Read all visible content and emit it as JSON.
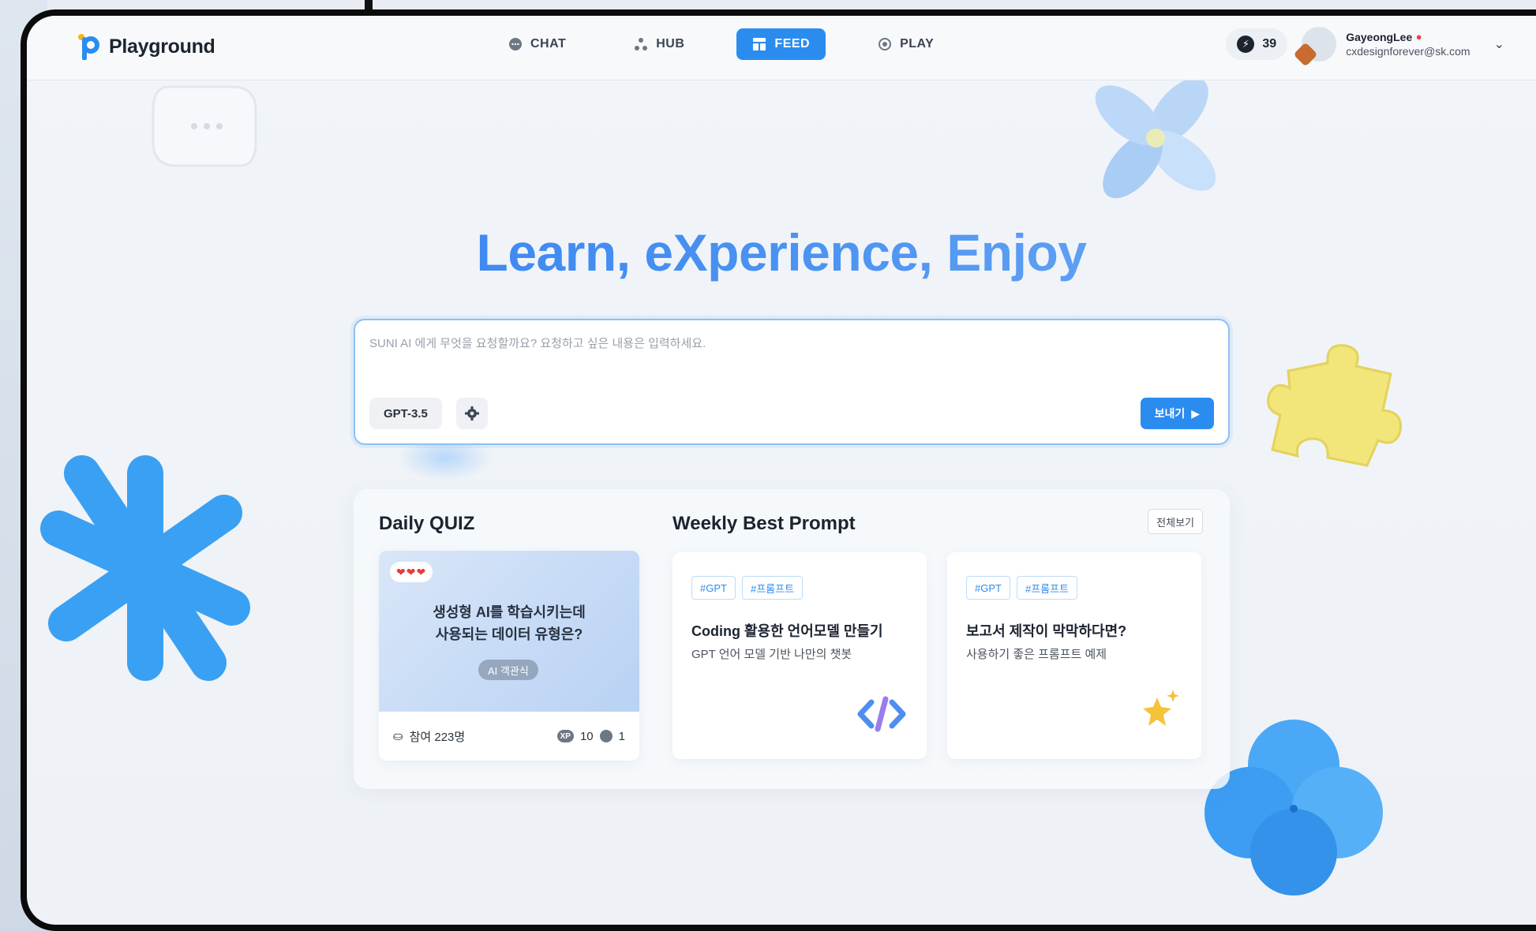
{
  "app": {
    "name": "Playground"
  },
  "nav": [
    {
      "label": "CHAT",
      "icon": "chat-icon",
      "active": false
    },
    {
      "label": "HUB",
      "icon": "hub-icon",
      "active": false
    },
    {
      "label": "FEED",
      "icon": "feed-icon",
      "active": true
    },
    {
      "label": "PLAY",
      "icon": "play-icon",
      "active": false
    }
  ],
  "header": {
    "points": "39",
    "user_name": "GayeongLee",
    "user_email": "cxdesignforever@sk.com"
  },
  "hero": {
    "title": "Learn, eXperience, Enjoy"
  },
  "prompt": {
    "placeholder": "SUNI AI 에게 무엇을 요청할까요? 요청하고 싶은 내용은 입력하세요.",
    "model": "GPT-3.5",
    "send_label": "보내기"
  },
  "quiz": {
    "section_title": "Daily QUIZ",
    "hearts": "❤❤❤",
    "question": "생성형 AI를 학습시키는데\n사용되는 데이터 유형은?",
    "tag": "AI 객관식",
    "participants": "참여 223명",
    "xp_badge": "XP",
    "xp": "10",
    "coins": "1"
  },
  "best_prompt": {
    "section_title": "Weekly Best Prompt",
    "view_all": "전체보기",
    "cards": [
      {
        "tags": [
          "#GPT",
          "#프롬프트"
        ],
        "title": "Coding 활용한 언어모델 만들기",
        "subtitle": "GPT 언어 모델 기반 나만의 챗봇",
        "icon": "code-icon"
      },
      {
        "tags": [
          "#GPT",
          "#프롬프트"
        ],
        "title": "보고서 제작이 막막하다면?",
        "subtitle": "사용하기 좋은 프롬프트 예제",
        "icon": "sparkle-icon"
      }
    ]
  },
  "colors": {
    "accent": "#2b8cf0",
    "hero_start": "#2f7df0",
    "hero_end": "#79b2f4"
  }
}
